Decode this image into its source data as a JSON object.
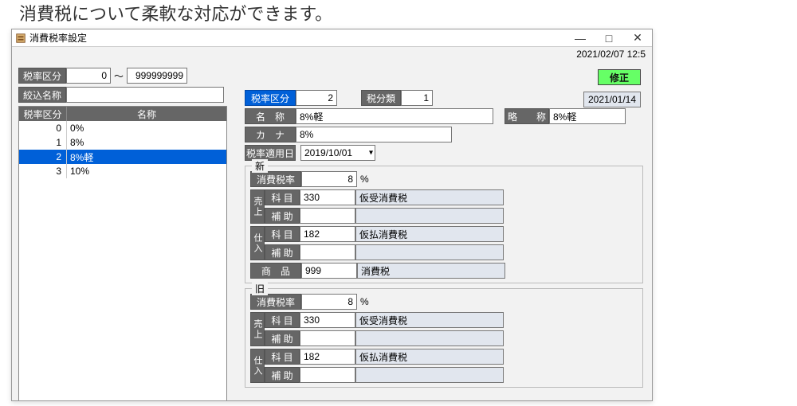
{
  "page_top_text": "消費税について柔軟な対応ができます。",
  "window": {
    "title": "消費税率設定",
    "min": "—",
    "max": "□",
    "close": "✕",
    "datetime": "2021/02/07   12:5"
  },
  "filter": {
    "label": "税率区分",
    "from": "0",
    "tilde": "～",
    "to": "999999999",
    "name_label": "絞込名称",
    "name_val": ""
  },
  "list": {
    "col1": "税率区分",
    "col2": "名称",
    "rows": [
      {
        "id": "0",
        "name": "0%"
      },
      {
        "id": "1",
        "name": "8%"
      },
      {
        "id": "2",
        "name": "8%軽"
      },
      {
        "id": "3",
        "name": "10%"
      }
    ],
    "selected": 2
  },
  "action": {
    "edit": "修正"
  },
  "rec_date": "2021/01/14",
  "detail": {
    "id_label": "税率区分",
    "id_val": "2",
    "class_label": "税分類",
    "class_val": "1",
    "name_label": "名　称",
    "name_val": "8%軽",
    "abbr_label": "略　　称",
    "abbr_val": "8%軽",
    "kana_label": "カ　ナ",
    "kana_val": "8%",
    "apply_label": "税率適用日",
    "apply_val": "2019/10/01"
  },
  "groups": {
    "new": {
      "title": "新",
      "rate_label": "消費税率",
      "rate_val": "8",
      "pct": "%",
      "sales_v": "売上",
      "purch_v": "仕入",
      "subj_label": "科 目",
      "aux_label": "補 助",
      "sales_subj": "330",
      "sales_subj_name": "仮受消費税",
      "sales_aux": "",
      "sales_aux_name": "",
      "purch_subj": "182",
      "purch_subj_name": "仮払消費税",
      "purch_aux": "",
      "purch_aux_name": "",
      "item_label": "商　品",
      "item_val": "999",
      "item_name": "消費税"
    },
    "old": {
      "title": "旧",
      "rate_label": "消費税率",
      "rate_val": "8",
      "pct": "%",
      "sales_v": "売上",
      "purch_v": "仕入",
      "subj_label": "科 目",
      "aux_label": "補 助",
      "sales_subj": "330",
      "sales_subj_name": "仮受消費税",
      "sales_aux": "",
      "sales_aux_name": "",
      "purch_subj": "182",
      "purch_subj_name": "仮払消費税",
      "purch_aux": "",
      "purch_aux_name": ""
    }
  }
}
